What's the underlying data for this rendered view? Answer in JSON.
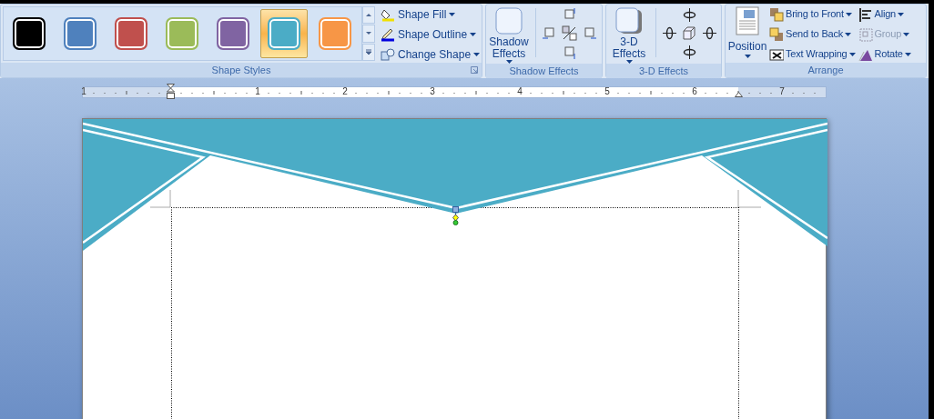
{
  "ribbon": {
    "shape_styles": {
      "swatches": [
        {
          "color": "#000000",
          "selected": false
        },
        {
          "color": "#4f81bd",
          "selected": false
        },
        {
          "color": "#c0504d",
          "selected": false
        },
        {
          "color": "#9bbb59",
          "selected": false
        },
        {
          "color": "#8064a2",
          "selected": false
        },
        {
          "color": "#4bacc6",
          "selected": true
        },
        {
          "color": "#f79646",
          "selected": false
        }
      ],
      "commands": [
        {
          "kind": "fill",
          "label": "Shape Fill"
        },
        {
          "kind": "outline",
          "label": "Shape Outline"
        },
        {
          "kind": "change",
          "label": "Change Shape"
        }
      ],
      "group_label": "Shape Styles"
    },
    "shadow_effects": {
      "button": "Shadow Effects",
      "group_label": "Shadow Effects"
    },
    "effects_3d": {
      "button": "3-D Effects",
      "group_label": "3-D Effects"
    },
    "arrange": {
      "position": "Position",
      "commands": [
        {
          "kind": "front",
          "label": "Bring to Front",
          "disabled": false
        },
        {
          "kind": "back",
          "label": "Send to Back",
          "disabled": false
        },
        {
          "kind": "wrap",
          "label": "Text Wrapping",
          "disabled": false
        },
        {
          "kind": "align",
          "label": "Align",
          "disabled": false
        },
        {
          "kind": "group",
          "label": "Group",
          "disabled": true
        },
        {
          "kind": "rotate",
          "label": "Rotate",
          "disabled": false
        }
      ],
      "group_label": "Arrange"
    }
  },
  "ruler": {
    "labels": [
      "1",
      "1",
      "2",
      "3",
      "4",
      "5",
      "6",
      "7"
    ]
  }
}
